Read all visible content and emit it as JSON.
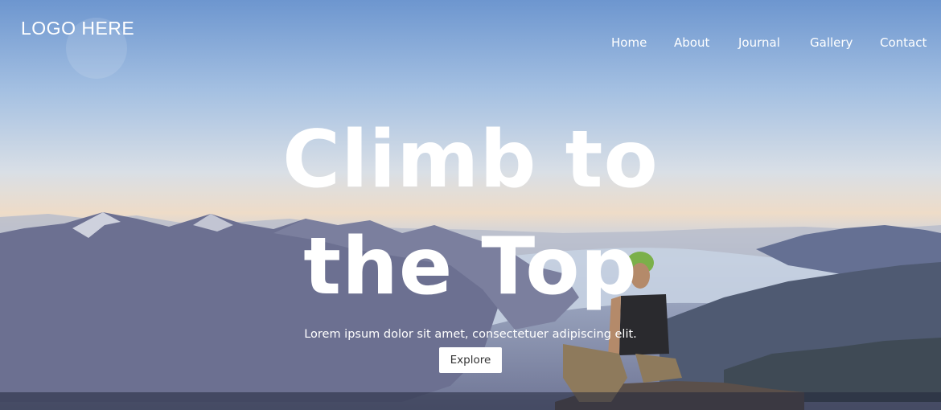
{
  "header": {
    "logo_text": "LOGO HERE",
    "nav": [
      {
        "label": "Home"
      },
      {
        "label": "About"
      },
      {
        "label": "Journal"
      },
      {
        "label": "Gallery"
      },
      {
        "label": "Contact"
      }
    ]
  },
  "hero": {
    "headline_line1": "Climb to",
    "headline_line2": "the Top",
    "subtitle": "Lorem ipsum dolor sit amet, consectetuer adipiscing elit.",
    "cta_label": "Explore",
    "background_image": "mountain-climber-landscape"
  },
  "colors": {
    "sky_top": "#6d96cf",
    "horizon": "#eedcc8",
    "mountains": "#5a6384",
    "button_bg": "#ffffff",
    "text": "#ffffff"
  }
}
